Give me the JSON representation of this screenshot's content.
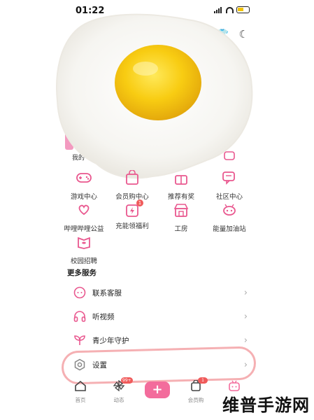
{
  "status": {
    "time": "01:22"
  },
  "partial": {
    "left_label": "我的"
  },
  "grid": [
    {
      "label": "游戏中心",
      "icon": "gamepad-icon"
    },
    {
      "label": "会员购中心",
      "icon": "shopping-bag-icon"
    },
    {
      "label": "推荐有奖",
      "icon": "gift-icon"
    },
    {
      "label": "社区中心",
      "icon": "chat-icon"
    },
    {
      "label": "哔哩哔哩公益",
      "icon": "heart-hands-icon"
    },
    {
      "label": "充能领福利",
      "icon": "calendar-lightning-icon",
      "badge": "1"
    },
    {
      "label": "工房",
      "icon": "shop-icon"
    },
    {
      "label": "能量加油站",
      "icon": "energy-station-icon"
    },
    {
      "label": "校园招聘",
      "icon": "campus-book-icon"
    }
  ],
  "more_services": {
    "title": "更多服务",
    "rows": [
      {
        "label": "联系客服",
        "icon": "headset-icon"
      },
      {
        "label": "听视频",
        "icon": "headphones-icon"
      },
      {
        "label": "青少年守护",
        "icon": "sprout-icon"
      },
      {
        "label": "设置",
        "icon": "gear-icon"
      }
    ]
  },
  "nav": {
    "items": [
      {
        "label": "首页",
        "icon": "home-icon"
      },
      {
        "label": "动态",
        "icon": "pinwheel-icon",
        "badge": "99+"
      },
      {
        "label": "",
        "icon": "plus-icon"
      },
      {
        "label": "会员购",
        "icon": "bag-icon",
        "badge": "1"
      },
      {
        "label": "",
        "icon": "tv-mascot-icon"
      }
    ],
    "plus_label": "+"
  },
  "watermark": "维普手游网",
  "colors": {
    "accent": "#f36c9c",
    "icon_pink": "#e9588f",
    "highlight": "#f3a2a6"
  }
}
